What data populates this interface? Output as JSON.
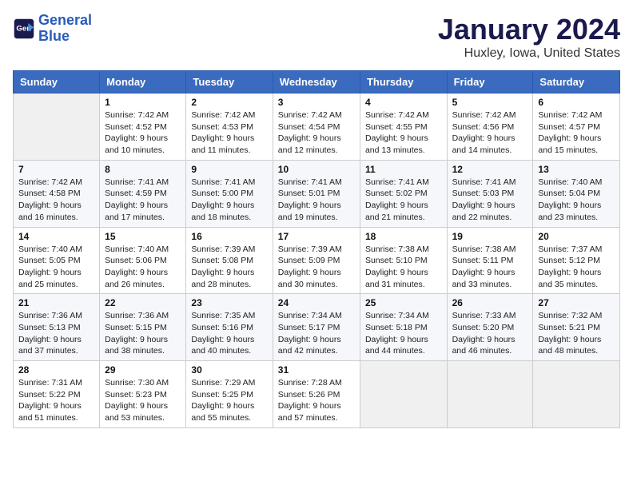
{
  "header": {
    "logo_line1": "General",
    "logo_line2": "Blue",
    "month": "January 2024",
    "location": "Huxley, Iowa, United States"
  },
  "weekdays": [
    "Sunday",
    "Monday",
    "Tuesday",
    "Wednesday",
    "Thursday",
    "Friday",
    "Saturday"
  ],
  "weeks": [
    [
      {
        "day": "",
        "info": ""
      },
      {
        "day": "1",
        "info": "Sunrise: 7:42 AM\nSunset: 4:52 PM\nDaylight: 9 hours\nand 10 minutes."
      },
      {
        "day": "2",
        "info": "Sunrise: 7:42 AM\nSunset: 4:53 PM\nDaylight: 9 hours\nand 11 minutes."
      },
      {
        "day": "3",
        "info": "Sunrise: 7:42 AM\nSunset: 4:54 PM\nDaylight: 9 hours\nand 12 minutes."
      },
      {
        "day": "4",
        "info": "Sunrise: 7:42 AM\nSunset: 4:55 PM\nDaylight: 9 hours\nand 13 minutes."
      },
      {
        "day": "5",
        "info": "Sunrise: 7:42 AM\nSunset: 4:56 PM\nDaylight: 9 hours\nand 14 minutes."
      },
      {
        "day": "6",
        "info": "Sunrise: 7:42 AM\nSunset: 4:57 PM\nDaylight: 9 hours\nand 15 minutes."
      }
    ],
    [
      {
        "day": "7",
        "info": "Sunrise: 7:42 AM\nSunset: 4:58 PM\nDaylight: 9 hours\nand 16 minutes."
      },
      {
        "day": "8",
        "info": "Sunrise: 7:41 AM\nSunset: 4:59 PM\nDaylight: 9 hours\nand 17 minutes."
      },
      {
        "day": "9",
        "info": "Sunrise: 7:41 AM\nSunset: 5:00 PM\nDaylight: 9 hours\nand 18 minutes."
      },
      {
        "day": "10",
        "info": "Sunrise: 7:41 AM\nSunset: 5:01 PM\nDaylight: 9 hours\nand 19 minutes."
      },
      {
        "day": "11",
        "info": "Sunrise: 7:41 AM\nSunset: 5:02 PM\nDaylight: 9 hours\nand 21 minutes."
      },
      {
        "day": "12",
        "info": "Sunrise: 7:41 AM\nSunset: 5:03 PM\nDaylight: 9 hours\nand 22 minutes."
      },
      {
        "day": "13",
        "info": "Sunrise: 7:40 AM\nSunset: 5:04 PM\nDaylight: 9 hours\nand 23 minutes."
      }
    ],
    [
      {
        "day": "14",
        "info": "Sunrise: 7:40 AM\nSunset: 5:05 PM\nDaylight: 9 hours\nand 25 minutes."
      },
      {
        "day": "15",
        "info": "Sunrise: 7:40 AM\nSunset: 5:06 PM\nDaylight: 9 hours\nand 26 minutes."
      },
      {
        "day": "16",
        "info": "Sunrise: 7:39 AM\nSunset: 5:08 PM\nDaylight: 9 hours\nand 28 minutes."
      },
      {
        "day": "17",
        "info": "Sunrise: 7:39 AM\nSunset: 5:09 PM\nDaylight: 9 hours\nand 30 minutes."
      },
      {
        "day": "18",
        "info": "Sunrise: 7:38 AM\nSunset: 5:10 PM\nDaylight: 9 hours\nand 31 minutes."
      },
      {
        "day": "19",
        "info": "Sunrise: 7:38 AM\nSunset: 5:11 PM\nDaylight: 9 hours\nand 33 minutes."
      },
      {
        "day": "20",
        "info": "Sunrise: 7:37 AM\nSunset: 5:12 PM\nDaylight: 9 hours\nand 35 minutes."
      }
    ],
    [
      {
        "day": "21",
        "info": "Sunrise: 7:36 AM\nSunset: 5:13 PM\nDaylight: 9 hours\nand 37 minutes."
      },
      {
        "day": "22",
        "info": "Sunrise: 7:36 AM\nSunset: 5:15 PM\nDaylight: 9 hours\nand 38 minutes."
      },
      {
        "day": "23",
        "info": "Sunrise: 7:35 AM\nSunset: 5:16 PM\nDaylight: 9 hours\nand 40 minutes."
      },
      {
        "day": "24",
        "info": "Sunrise: 7:34 AM\nSunset: 5:17 PM\nDaylight: 9 hours\nand 42 minutes."
      },
      {
        "day": "25",
        "info": "Sunrise: 7:34 AM\nSunset: 5:18 PM\nDaylight: 9 hours\nand 44 minutes."
      },
      {
        "day": "26",
        "info": "Sunrise: 7:33 AM\nSunset: 5:20 PM\nDaylight: 9 hours\nand 46 minutes."
      },
      {
        "day": "27",
        "info": "Sunrise: 7:32 AM\nSunset: 5:21 PM\nDaylight: 9 hours\nand 48 minutes."
      }
    ],
    [
      {
        "day": "28",
        "info": "Sunrise: 7:31 AM\nSunset: 5:22 PM\nDaylight: 9 hours\nand 51 minutes."
      },
      {
        "day": "29",
        "info": "Sunrise: 7:30 AM\nSunset: 5:23 PM\nDaylight: 9 hours\nand 53 minutes."
      },
      {
        "day": "30",
        "info": "Sunrise: 7:29 AM\nSunset: 5:25 PM\nDaylight: 9 hours\nand 55 minutes."
      },
      {
        "day": "31",
        "info": "Sunrise: 7:28 AM\nSunset: 5:26 PM\nDaylight: 9 hours\nand 57 minutes."
      },
      {
        "day": "",
        "info": ""
      },
      {
        "day": "",
        "info": ""
      },
      {
        "day": "",
        "info": ""
      }
    ]
  ]
}
